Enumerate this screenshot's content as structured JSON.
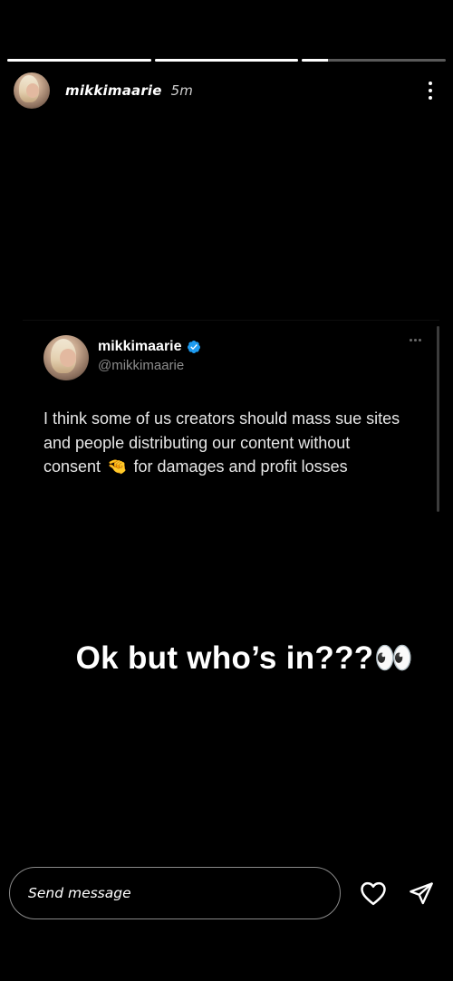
{
  "story": {
    "progress": [
      1.0,
      1.0,
      0.18
    ],
    "username": "mikkimaarie",
    "time_ago": "5m",
    "more_icon": "more-vertical-icon"
  },
  "tweet": {
    "display_name": "mikkimaarie",
    "handle": "@mikkimaarie",
    "verified": true,
    "verified_color": "#1d9bf0",
    "text_before_emoji": "I think some of us creators should mass sue sites and people distributing our content without consent ",
    "emoji": "🤏",
    "text_after_emoji": " for damages and profit losses",
    "more_icon": "more-horizontal-icon"
  },
  "caption": {
    "text": "Ok but who’s in???",
    "emoji": "👀"
  },
  "reply": {
    "placeholder": "Send message",
    "like_icon": "heart-icon",
    "send_icon": "paper-plane-icon"
  },
  "colors": {
    "background": "#000000",
    "text": "#ffffff",
    "muted": "#8b8b8b",
    "input_border": "#8a8a8a"
  }
}
